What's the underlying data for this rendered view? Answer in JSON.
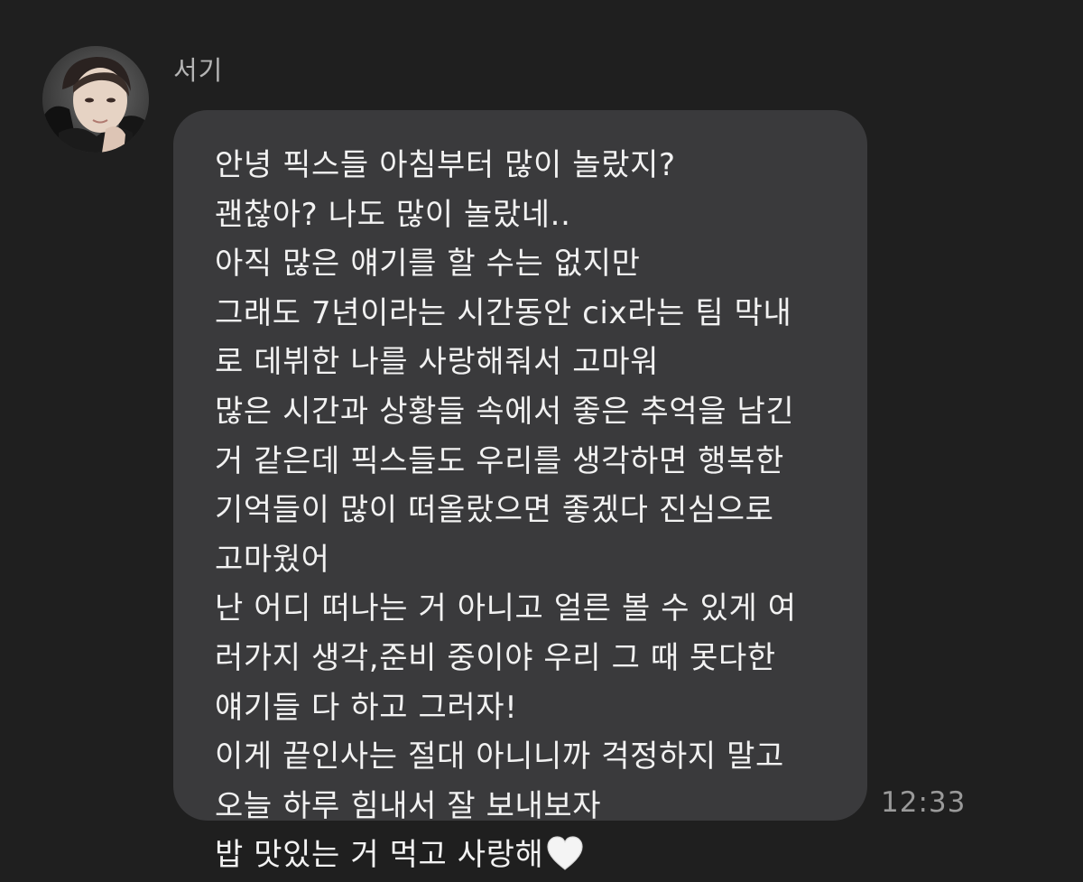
{
  "sender": {
    "name": "서기",
    "avatar_icon": "profile-photo"
  },
  "message": {
    "lines": [
      "안녕 픽스들 아침부터 많이 놀랐지?",
      "괜찮아? 나도 많이 놀랐네..",
      "아직 많은 얘기를 할 수는 없지만",
      "그래도 7년이라는 시간동안 cix라는 팀 막내",
      "로 데뷔한 나를 사랑해줘서 고마워",
      "많은 시간과 상황들 속에서 좋은 추억을 남긴",
      "거 같은데 픽스들도 우리를 생각하면 행복한",
      "기억들이 많이 떠올랐으면 좋겠다 진심으로",
      "고마웠어",
      "난 어디 떠나는 거 아니고 얼른 볼 수 있게 여",
      "러가지 생각,준비 중이야 우리 그 때 못다한",
      "얘기들 다 하고 그러자!",
      "이게 끝인사는 절대 아니니까 걱정하지 말고",
      "오늘 하루 힘내서 잘 보내보자",
      "밥 맛있는 거 먹고 사랑해"
    ],
    "trailing_emoji": "white-heart-icon",
    "time": "12:33"
  },
  "colors": {
    "background": "#1f1f1f",
    "bubble": "#3a3a3c",
    "text": "#f2f2f2",
    "name": "#b4b4b4",
    "time": "#9a9a9a"
  }
}
